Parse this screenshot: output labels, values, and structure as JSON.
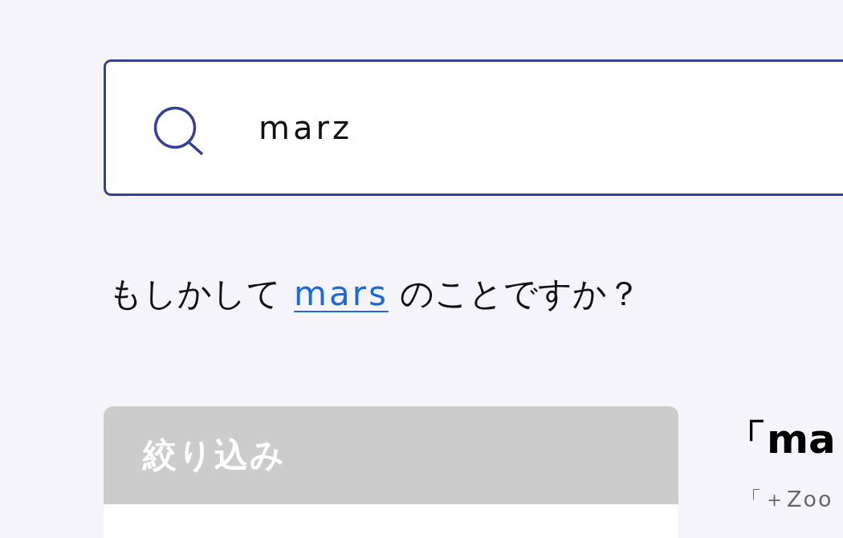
{
  "search": {
    "value": "marz"
  },
  "suggestion": {
    "prefix": "もしかして",
    "link": "mars",
    "suffix": "のことですか？"
  },
  "filter_panel": {
    "title": "絞り込み"
  },
  "results": {
    "heading": "「ma",
    "subheading": "「＋Zoo"
  }
}
